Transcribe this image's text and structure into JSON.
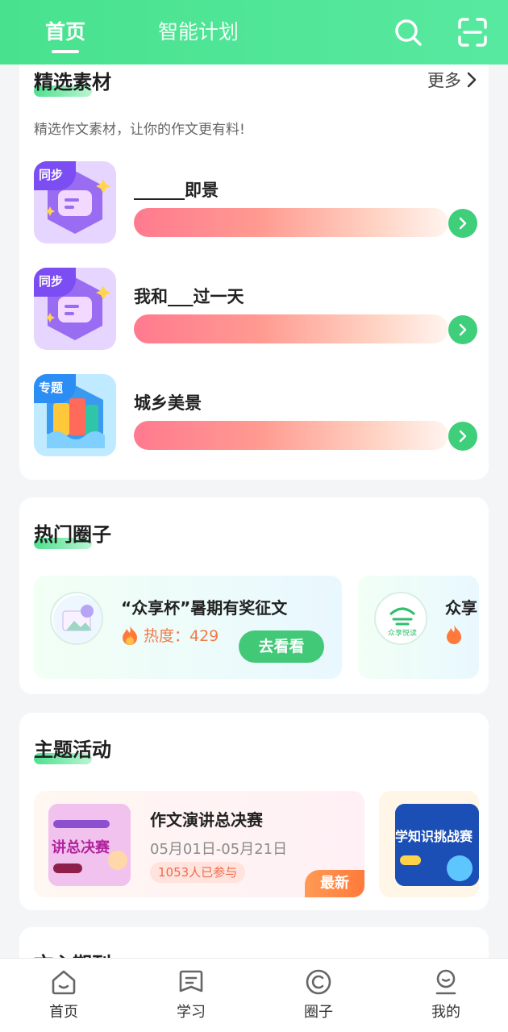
{
  "header": {
    "tabs": [
      {
        "label": "首页",
        "active": true
      },
      {
        "label": "智能计划",
        "active": false
      }
    ],
    "icons": [
      "search-icon",
      "scan-icon"
    ]
  },
  "materials": {
    "title": "精选素材",
    "more": "更多",
    "subtitle": "精选作文素材，让你的作文更有料!",
    "items": [
      {
        "badge": "同步",
        "name": "______即景"
      },
      {
        "badge": "同步",
        "name": "我和___过一天"
      },
      {
        "badge": "专题",
        "name": "城乡美景"
      }
    ]
  },
  "hot_circles": {
    "title": "热门圈子",
    "items": [
      {
        "title": "“众享杯”暑期有奖征文",
        "heat": "热度：429",
        "button": "去看看"
      },
      {
        "title": "众享",
        "logo_text": "众享悦读"
      }
    ]
  },
  "activities": {
    "title": "主题活动",
    "items": [
      {
        "title": "作文演讲总决赛",
        "date": "05月01日-05月21日",
        "participants": "1053人已参与",
        "badge": "最新",
        "poster_text": "讲总决赛"
      },
      {
        "poster_text": "学知识挑战赛"
      }
    ]
  },
  "journal": {
    "title": "文心期刊"
  },
  "bottom_nav": [
    {
      "label": "首页",
      "icon": "home-icon"
    },
    {
      "label": "学习",
      "icon": "study-icon"
    },
    {
      "label": "圈子",
      "icon": "circle-icon"
    },
    {
      "label": "我的",
      "icon": "profile-icon"
    }
  ],
  "colors": {
    "brand_green": "#48e28e",
    "accent_orange": "#f07a4a"
  }
}
